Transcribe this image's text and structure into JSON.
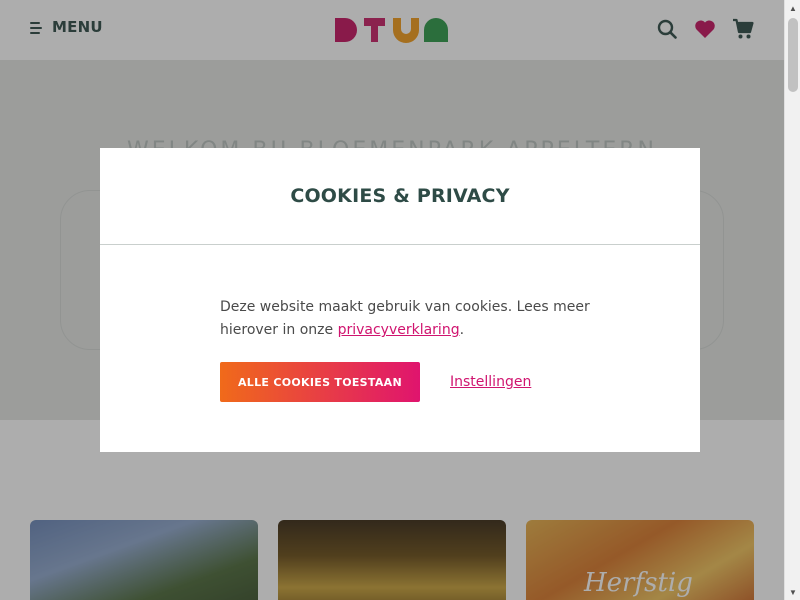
{
  "header": {
    "menu_label": "MENU",
    "logo_text": "DTVA",
    "icons": [
      "search-icon",
      "heart-icon",
      "cart-icon"
    ]
  },
  "hero": {
    "title": "Welkom bij Bloemenpark Appeltern"
  },
  "cards": [
    {
      "label": ""
    },
    {
      "label": ""
    },
    {
      "label": "Herfstig"
    }
  ],
  "modal": {
    "title": "COOKIES & PRIVACY",
    "text_before": "Deze website maakt gebruik van cookies. Lees meer hierover in onze ",
    "link": "privacyverklaring",
    "text_after": ".",
    "accept_button": "ALLE COOKIES TOESTAAN",
    "settings_link": "Instellingen"
  },
  "colors": {
    "brand_dark": "#2e4b46",
    "accent_pink": "#d0146f",
    "accent_orange": "#f06a1a",
    "logo_magenta": "#c5135f",
    "logo_orange": "#f39c1a",
    "logo_green": "#2e9a4a"
  }
}
